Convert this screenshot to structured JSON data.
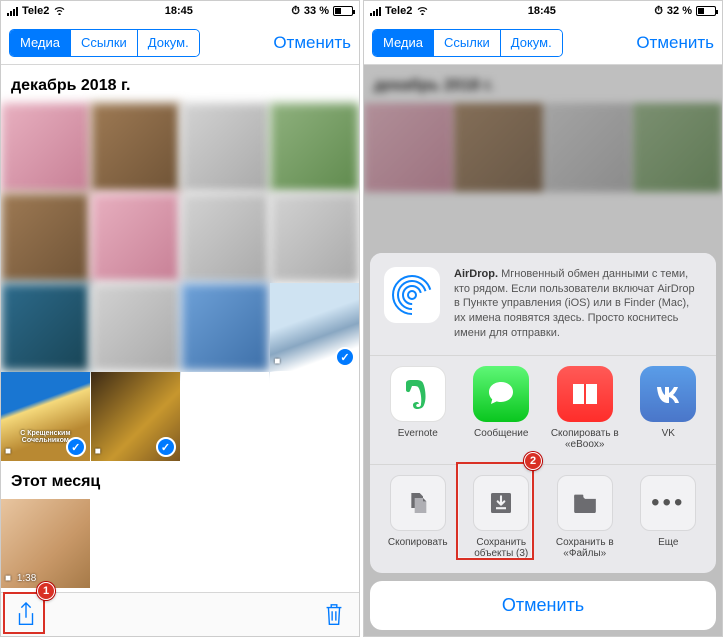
{
  "status": {
    "carrier": "Tele2",
    "time": "18:45",
    "battery_left": "33 %",
    "battery_right": "32 %"
  },
  "navbar": {
    "seg_media": "Медиа",
    "seg_links": "Ссылки",
    "seg_docs": "Докум.",
    "cancel": "Отменить"
  },
  "sections": {
    "december": "декабрь 2018 г.",
    "this_month": "Этот месяц"
  },
  "thumbs": {
    "vid_duration": "1:38",
    "caption_kresh": "С Крещенским Сочельником"
  },
  "callouts": {
    "one": "1",
    "two": "2"
  },
  "airdrop": {
    "title": "AirDrop.",
    "body": "Мгновенный обмен данными с теми, кто рядом. Если пользователи включат AirDrop в Пункте управления (iOS) или в Finder (Mac), их имена появятся здесь. Просто коснитесь имени для отправки."
  },
  "apps": {
    "evernote": "Evernote",
    "messages": "Сообщение",
    "eboox": "Скопировать в «eBoox»",
    "vk": "VK"
  },
  "actions": {
    "copy": "Скопировать",
    "save_objects": "Сохранить объекты (3)",
    "save_files": "Сохранить в «Файлы»",
    "more": "Еще"
  },
  "sheet": {
    "cancel": "Отменить"
  }
}
